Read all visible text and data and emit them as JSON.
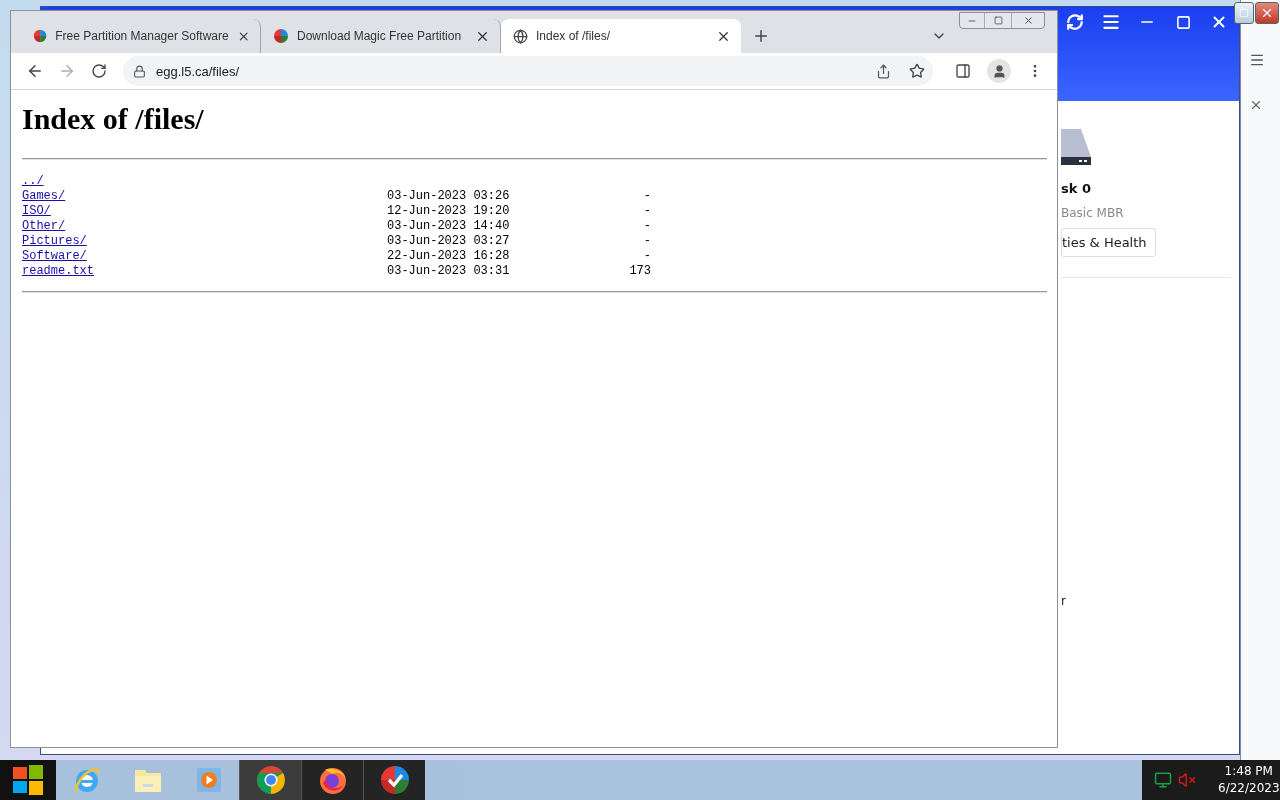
{
  "browser": {
    "tabs": [
      {
        "title": "Free Partition Manager Software",
        "selected": false,
        "kind": "app"
      },
      {
        "title": "Download Magic Free Partition",
        "selected": false,
        "kind": "app"
      },
      {
        "title": "Index of /files/",
        "selected": true,
        "kind": "web"
      }
    ],
    "address": "egg.l5.ca/files/",
    "page": {
      "heading": "Index of /files/",
      "entries": [
        {
          "name": "../"
        },
        {
          "name": "Games/",
          "date": "03-Jun-2023 03:26",
          "size": "-"
        },
        {
          "name": "ISO/",
          "date": "12-Jun-2023 19:20",
          "size": "-"
        },
        {
          "name": "Other/",
          "date": "03-Jun-2023 14:40",
          "size": "-"
        },
        {
          "name": "Pictures/",
          "date": "03-Jun-2023 03:27",
          "size": "-"
        },
        {
          "name": "Software/",
          "date": "22-Jun-2023 16:28",
          "size": "-"
        },
        {
          "name": "readme.txt",
          "date": "03-Jun-2023 03:31",
          "size": "173"
        }
      ]
    }
  },
  "back_window": {
    "disk_title": "sk 0",
    "disk_type": "Basic MBR",
    "button": "ties & Health",
    "footer_text": "r"
  },
  "taskbar": {
    "apps": [
      {
        "kind": "ie",
        "running": false,
        "selected": false
      },
      {
        "kind": "explorer",
        "running": false,
        "selected": false
      },
      {
        "kind": "media",
        "running": false,
        "selected": false
      },
      {
        "kind": "chrome",
        "running": true,
        "selected": true
      },
      {
        "kind": "firefox",
        "running": true,
        "selected": false
      },
      {
        "kind": "partition",
        "running": true,
        "selected": false
      }
    ],
    "time": "1:48 PM",
    "date": "6/22/2023"
  }
}
